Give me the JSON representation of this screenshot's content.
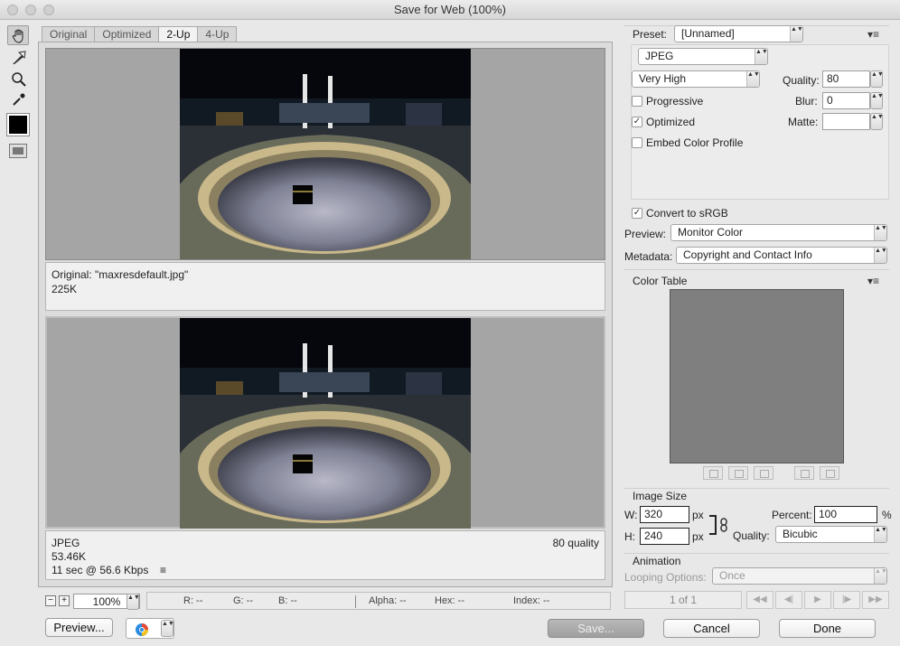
{
  "window": {
    "title": "Save for Web (100%)"
  },
  "tabs": [
    "Original",
    "Optimized",
    "2-Up",
    "4-Up"
  ],
  "panes": {
    "original": {
      "line1": "Original: \"maxresdefault.jpg\"",
      "line2": "225K"
    },
    "optimized": {
      "format": "JPEG",
      "size": "53.46K",
      "time": "11 sec @ 56.6 Kbps",
      "quality": "80 quality",
      "menu_icon": "≡"
    }
  },
  "bottom": {
    "zoom": "100%",
    "minus": "−",
    "plus": "+",
    "status": {
      "r": "R: --",
      "g": "G: --",
      "b": "B: --",
      "alpha": "Alpha: --",
      "hex": "Hex: --",
      "index": "Index: --"
    },
    "preview_btn": "Preview...",
    "save_btn": "Save...",
    "cancel_btn": "Cancel",
    "done_btn": "Done"
  },
  "settings": {
    "preset_label": "Preset:",
    "preset_value": "[Unnamed]",
    "format": "JPEG",
    "quality_preset": "Very High",
    "quality_label": "Quality:",
    "quality_value": "80",
    "blur_label": "Blur:",
    "blur_value": "0",
    "matte_label": "Matte:",
    "matte_value": "",
    "progressive_label": "Progressive",
    "optimized_label": "Optimized",
    "embed_label": "Embed Color Profile",
    "srgb_label": "Convert to sRGB",
    "preview_label": "Preview:",
    "preview_value": "Monitor Color",
    "metadata_label": "Metadata:",
    "metadata_value": "Copyright and Contact Info",
    "check_mark": "✓"
  },
  "color_table": {
    "title": "Color Table"
  },
  "image_size": {
    "title": "Image Size",
    "w_label": "W:",
    "w_value": "320",
    "h_label": "H:",
    "h_value": "240",
    "px": "px",
    "percent_label": "Percent:",
    "percent_value": "100",
    "percent_sign": "%",
    "quality_label": "Quality:",
    "quality_value": "Bicubic"
  },
  "animation": {
    "title": "Animation",
    "looping_label": "Looping Options:",
    "looping_value": "Once",
    "frame": "1 of 1",
    "first": "◀◀",
    "prev": "◀|",
    "play": "▶",
    "next": "|▶",
    "last": "▶▶"
  },
  "arrows": "▲▼"
}
